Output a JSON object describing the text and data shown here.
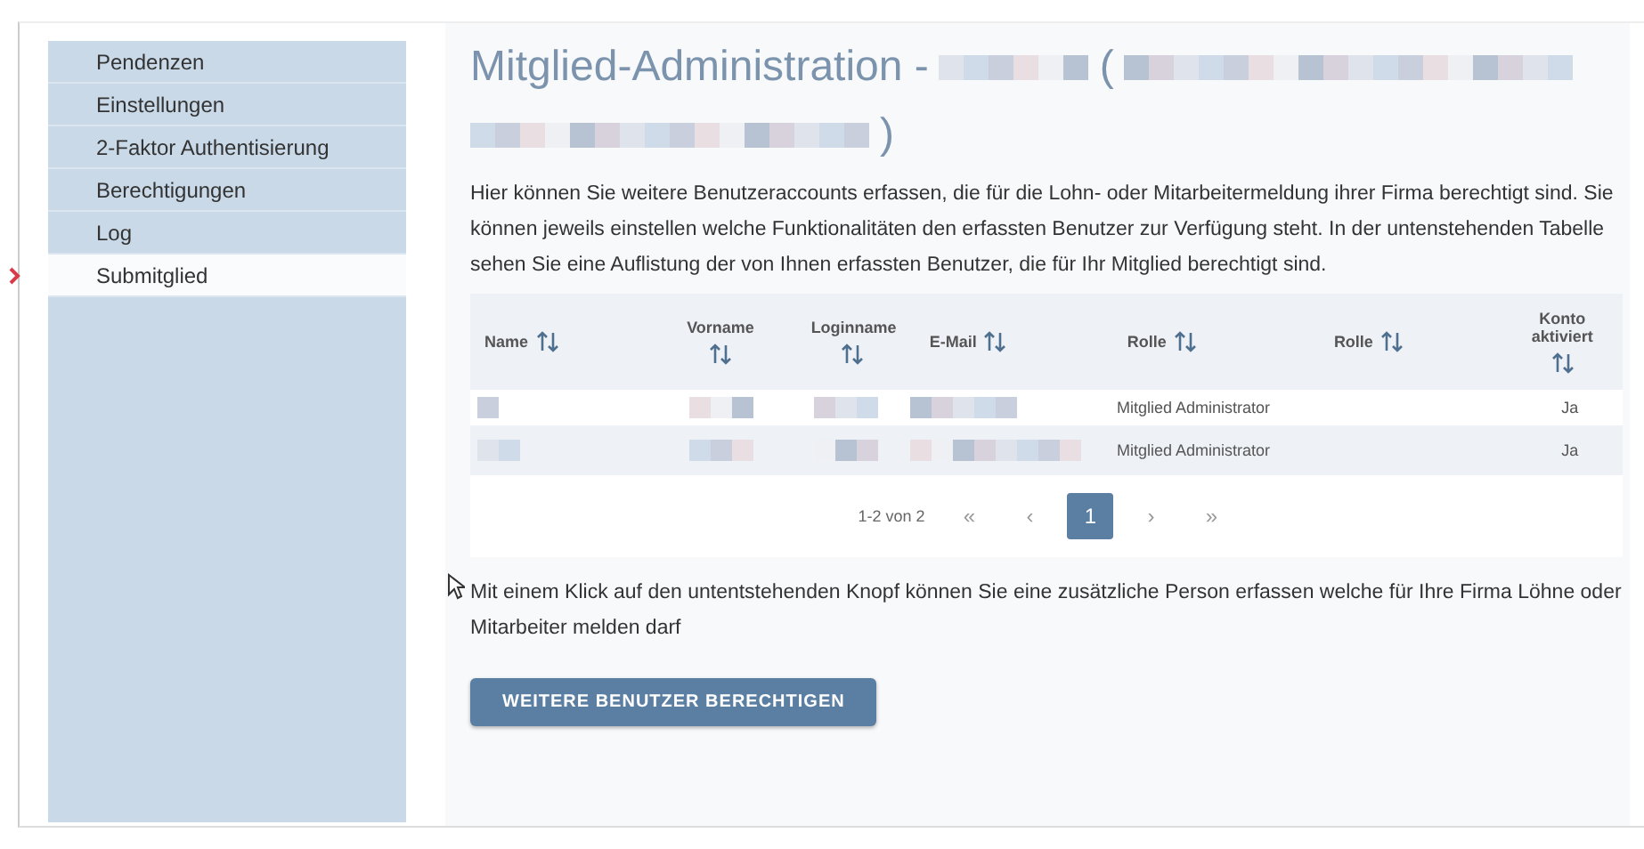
{
  "sidebar": {
    "items": [
      {
        "label": "Pendenzen",
        "selected": false
      },
      {
        "label": "Einstellungen",
        "selected": false
      },
      {
        "label": "2-Faktor Authentisierung",
        "selected": false
      },
      {
        "label": "Berechtigungen",
        "selected": false
      },
      {
        "label": "Log",
        "selected": false
      },
      {
        "label": "Submitglied",
        "selected": true
      }
    ]
  },
  "title": {
    "prefix": "Mitglied-Administration -",
    "open_paren": "(",
    "close_paren": ")"
  },
  "intro": "Hier können Sie weitere Benutzeraccounts erfassen, die für die Lohn- oder Mitarbeitermeldung ihrer Firma berechtigt sind. Sie können jeweils einstellen welche Funktionalitäten den erfassten Benutzer zur Verfügung steht. In der untenstehenden Tabelle sehen Sie eine Auflistung der von Ihnen erfassten Benutzer, die für Ihr Mitglied berechtigt sind.",
  "table": {
    "columns": [
      {
        "label": "Name"
      },
      {
        "label": "Vorname"
      },
      {
        "label": "Loginname"
      },
      {
        "label": "E-Mail"
      },
      {
        "label": "Rolle"
      },
      {
        "label": "Rolle"
      },
      {
        "label": "Konto aktiviert"
      }
    ],
    "rows": [
      {
        "role": "Mitglied Administrator",
        "account_active": "Ja"
      },
      {
        "role": "Mitglied Administrator",
        "account_active": "Ja"
      }
    ]
  },
  "pagination": {
    "summary": "1-2 von 2",
    "controls": [
      {
        "label": "«",
        "selected": false
      },
      {
        "label": "‹",
        "selected": false
      },
      {
        "label": "1",
        "selected": true
      },
      {
        "label": "›",
        "selected": false
      },
      {
        "label": "»",
        "selected": false
      }
    ]
  },
  "note": "Mit einem Klick auf den untentstehenden Knopf können Sie eine zusätzliche Person erfassen welche für Ihre Firma Löhne oder Mitarbeiter melden darf",
  "button": "WEITERE BENUTZER BERECHTIGEN"
}
